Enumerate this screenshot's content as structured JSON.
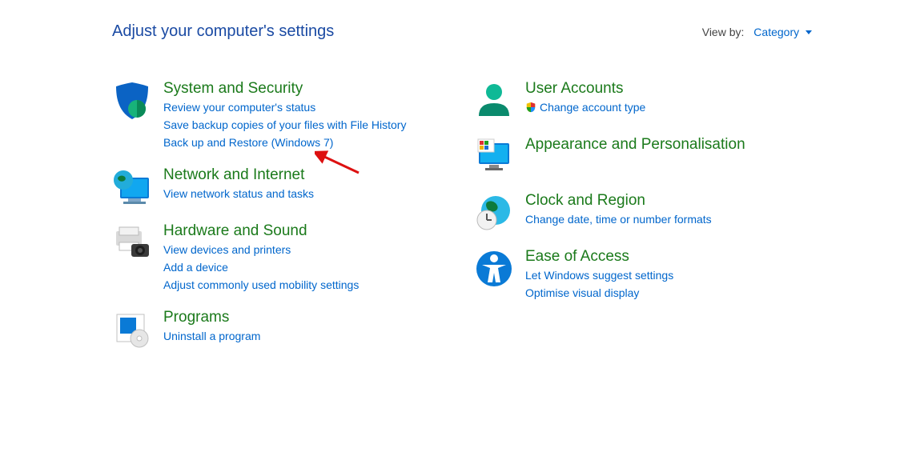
{
  "header": {
    "title": "Adjust your computer's settings",
    "viewby_label": "View by:",
    "viewby_value": "Category"
  },
  "left": [
    {
      "name": "System and Security",
      "icon": "security-shield-icon",
      "links": [
        "Review your computer's status",
        "Save backup copies of your files with File History",
        "Back up and Restore (Windows 7)"
      ]
    },
    {
      "name": "Network and Internet",
      "icon": "network-globe-icon",
      "links": [
        "View network status and tasks"
      ]
    },
    {
      "name": "Hardware and Sound",
      "icon": "printer-camera-icon",
      "links": [
        "View devices and printers",
        "Add a device",
        "Adjust commonly used mobility settings"
      ]
    },
    {
      "name": "Programs",
      "icon": "programs-disc-icon",
      "links": [
        "Uninstall a program"
      ]
    }
  ],
  "right": [
    {
      "name": "User Accounts",
      "icon": "user-accounts-icon",
      "links": [
        "Change account type"
      ],
      "shield_first": true
    },
    {
      "name": "Appearance and Personalisation",
      "icon": "appearance-monitor-icon",
      "links": []
    },
    {
      "name": "Clock and Region",
      "icon": "clock-globe-icon",
      "links": [
        "Change date, time or number formats"
      ]
    },
    {
      "name": "Ease of Access",
      "icon": "ease-of-access-icon",
      "links": [
        "Let Windows suggest settings",
        "Optimise visual display"
      ]
    }
  ]
}
